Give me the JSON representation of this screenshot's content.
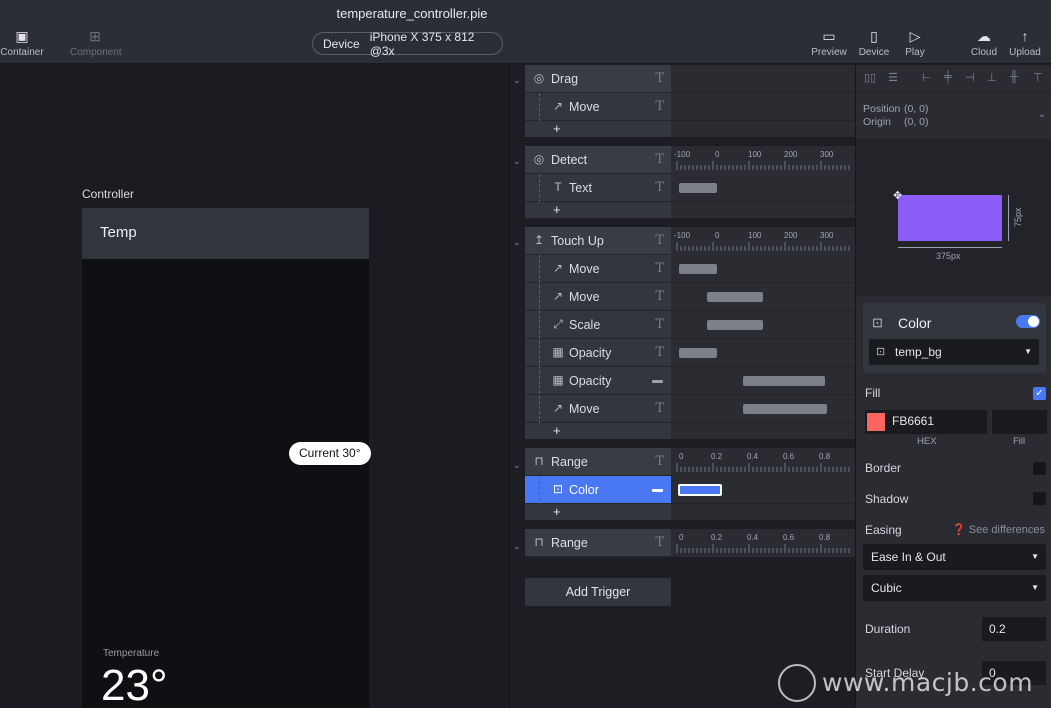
{
  "window": {
    "title": "temperature_controller.pie"
  },
  "toolbar": {
    "container": "Container",
    "component": "Component",
    "device_label": "Device",
    "device_spec": "iPhone X  375 x 812  @3x",
    "preview": "Preview",
    "device": "Device",
    "play": "Play",
    "cloud": "Cloud",
    "upload": "Upload"
  },
  "canvas": {
    "controller_label": "Controller",
    "header_text": "Temp",
    "current_pill": "Current 30°",
    "temperature_label": "Temperature",
    "temperature_value": "23°"
  },
  "triggers": [
    {
      "name": "Drag",
      "icon": "target-icon",
      "children": [
        {
          "name": "Move",
          "icon": "move-icon"
        }
      ]
    },
    {
      "name": "Detect",
      "icon": "target-icon",
      "children": [
        {
          "name": "Text",
          "icon": "text-icon"
        }
      ]
    },
    {
      "name": "Touch Up",
      "icon": "touch-up-icon",
      "children": [
        {
          "name": "Move",
          "icon": "move-icon"
        },
        {
          "name": "Move",
          "icon": "move-icon"
        },
        {
          "name": "Scale",
          "icon": "scale-icon"
        },
        {
          "name": "Opacity",
          "icon": "opacity-icon"
        },
        {
          "name": "Opacity",
          "icon": "opacity-icon"
        },
        {
          "name": "Move",
          "icon": "move-icon"
        }
      ]
    },
    {
      "name": "Range",
      "icon": "range-icon",
      "children": [
        {
          "name": "Color",
          "icon": "color-icon"
        }
      ]
    },
    {
      "name": "Range",
      "icon": "range-icon",
      "children": []
    }
  ],
  "add_symbol": "+",
  "type_glyph": "T",
  "add_trigger": "Add Trigger",
  "ruler_ms": [
    "-100",
    "0",
    "100",
    "200",
    "300"
  ],
  "ruler_range": [
    "0",
    "0.2",
    "0.4",
    "0.6",
    "0.8"
  ],
  "inspector": {
    "position_label": "Position",
    "position_value": "(0, 0)",
    "origin_label": "Origin",
    "origin_value": "(0, 0)",
    "width_label": "375px",
    "height_label": "75px",
    "color_title": "Color",
    "layer_value": "temp_bg",
    "fill_label": "Fill",
    "hex_value": "FB6661",
    "hex_caption": "HEX",
    "fill_caption": "Fill",
    "border_label": "Border",
    "shadow_label": "Shadow",
    "easing_label": "Easing",
    "see_differences": "See differences",
    "easing_value": "Ease In & Out",
    "curve_value": "Cubic",
    "duration_label": "Duration",
    "duration_value": "0.2",
    "start_delay_label": "Start Delay",
    "start_delay_value": "0"
  },
  "colors": {
    "accent": "#4a78f5",
    "fill_swatch": "#fb6661",
    "shape": "#8b5cf6"
  },
  "watermark": "www.macjb.com"
}
